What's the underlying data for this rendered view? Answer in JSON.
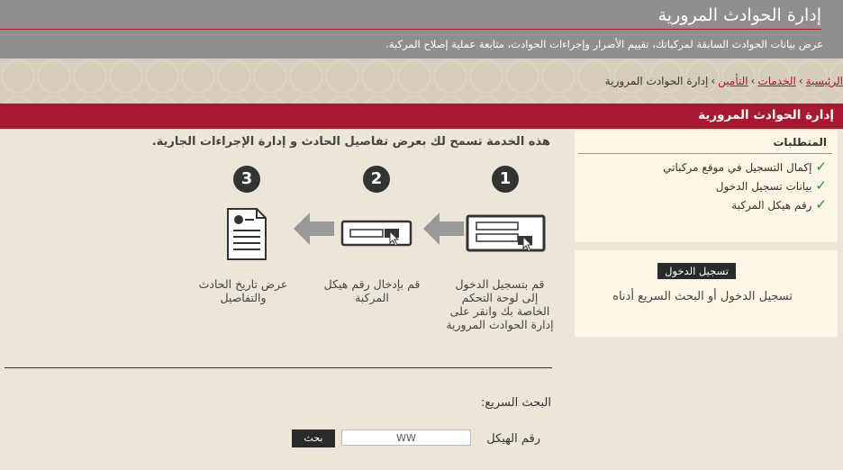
{
  "header": {
    "title": "إدارة الحوادث المرورية",
    "subtitle": "عرض بيانات الحوادث السابقة لمركباتك، تقييم الأضرار وإجراءات الحوادث، متابعة عملية إصلاح المركبة."
  },
  "breadcrumb": {
    "items": [
      "الرئيسية",
      "الخدمات",
      "التأمين"
    ],
    "current": "إدارة الحوادث المرورية",
    "separator": "›"
  },
  "section": {
    "title": "إدارة الحوادث المرورية"
  },
  "intro": "هذه الخدمة تسمح لك بعرض تفاصيل الحادث و إدارة الإجراءات الجارية.",
  "steps": [
    {
      "number": "1",
      "text": "قم بتسجيل الدخول إلى لوحة التحكم الخاصة بك وانقر على إدارة الحوادث المرورية"
    },
    {
      "number": "2",
      "text": "قم بإدخال رقم هيكل المركبة"
    },
    {
      "number": "3",
      "text": "عرض تاريخ الحادث والتفاصيل"
    }
  ],
  "requirements": {
    "title": "المتطلبات",
    "items": [
      "إكمال التسجيل في موقع مركباتي",
      "بيانات تسجيل الدخول",
      "رقم هيكل المركبة"
    ]
  },
  "login": {
    "button": "تسجيل الدخول",
    "text": "تسجيل الدخول أو البحث السريع أدناه"
  },
  "quick_search": {
    "label": "البحث السريع:",
    "chassis_label": "رقم الهيكل",
    "chassis_value": "WW",
    "search_button": "بحث"
  },
  "colors": {
    "accent": "#a6192e",
    "header_bg": "#8f8f90",
    "page_bg": "#ebe6d9",
    "card_bg": "#fbf6e6",
    "check": "#2e8b2e"
  }
}
